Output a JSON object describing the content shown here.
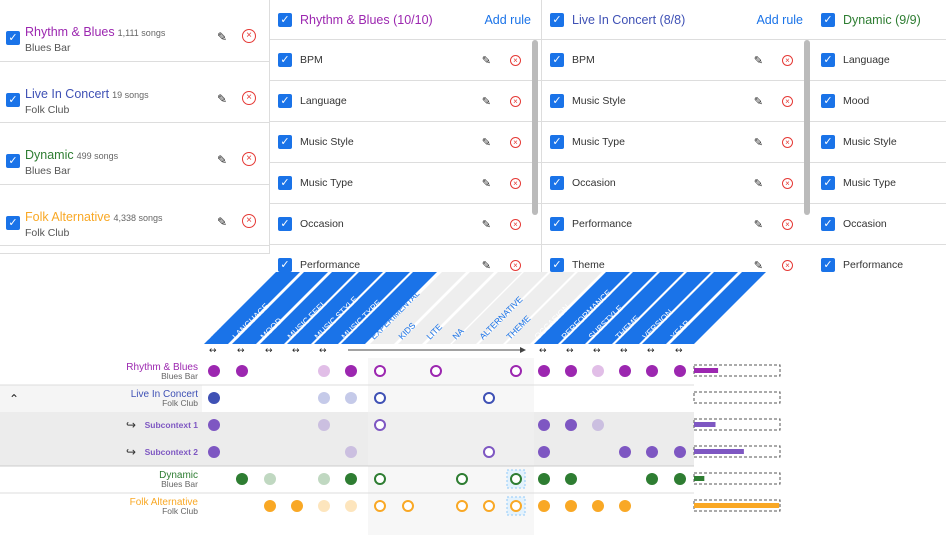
{
  "contexts": [
    {
      "name": "Rhythm & Blues",
      "count": "1,111 songs",
      "venue": "Blues Bar",
      "color": "#9c27b0"
    },
    {
      "name": "Live In Concert",
      "count": "19 songs",
      "venue": "Folk Club",
      "color": "#3f51b5"
    },
    {
      "name": "Dynamic",
      "count": "499 songs",
      "venue": "Blues Bar",
      "color": "#2e7d32"
    },
    {
      "name": "Folk Alternative",
      "count": "4,338 songs",
      "venue": "Folk Club",
      "color": "#f9a825"
    }
  ],
  "panels": [
    {
      "title": "Rhythm & Blues (10/10)",
      "color": "#9c27b0",
      "add": "Add rule",
      "rules": [
        "BPM",
        "Language",
        "Music Style",
        "Music Type",
        "Occasion",
        "Performance"
      ]
    },
    {
      "title": "Live In Concert (8/8)",
      "color": "#3f51b5",
      "add": "Add rule",
      "rules": [
        "BPM",
        "Music Style",
        "Music Type",
        "Occasion",
        "Performance",
        "Theme"
      ]
    },
    {
      "title": "Dynamic (9/9)",
      "color": "#2e7d32",
      "add": "",
      "rules": [
        "Language",
        "Mood",
        "Music Style",
        "Music Type",
        "Occasion",
        "Performance"
      ]
    }
  ],
  "columns": [
    "BPM",
    "LANGUAGE",
    "MOOD",
    "MUSIC FEEL",
    "MUSIC STYLE",
    "MUSIC TYPE",
    "EXPERIMENTAL",
    "KIDS",
    "LITE",
    "NA",
    "ALTERNATIVE",
    "THEME",
    "OCCASION",
    "PERFORMANCE",
    "SUBSTYLE",
    "THEME",
    "VERSION",
    "YEAR"
  ],
  "rows": [
    {
      "a": "Rhythm & Blues",
      "b": "Blues Bar",
      "color": "#9c27b0"
    },
    {
      "a": "Live In Concert",
      "b": "Folk Club",
      "color": "#3f51b5"
    },
    {
      "a": "Subcontext 1",
      "b": "",
      "color": "#7e57c2"
    },
    {
      "a": "Subcontext 2",
      "b": "",
      "color": "#7e57c2"
    },
    {
      "a": "Dynamic",
      "b": "Blues Bar",
      "color": "#2e7d32"
    },
    {
      "a": "Folk Alternative",
      "b": "Folk Club",
      "color": "#f9a825"
    }
  ],
  "bars": [
    0.28,
    0,
    0.25,
    0.58,
    0.12,
    0.99
  ],
  "icons": {
    "checkbox": "check-icon",
    "edit": "pencil-icon",
    "delete": "close-circle-icon",
    "collapse": "chevron-up-icon",
    "sub": "subdirectory-arrow-icon",
    "resize": "column-resize-icon"
  }
}
